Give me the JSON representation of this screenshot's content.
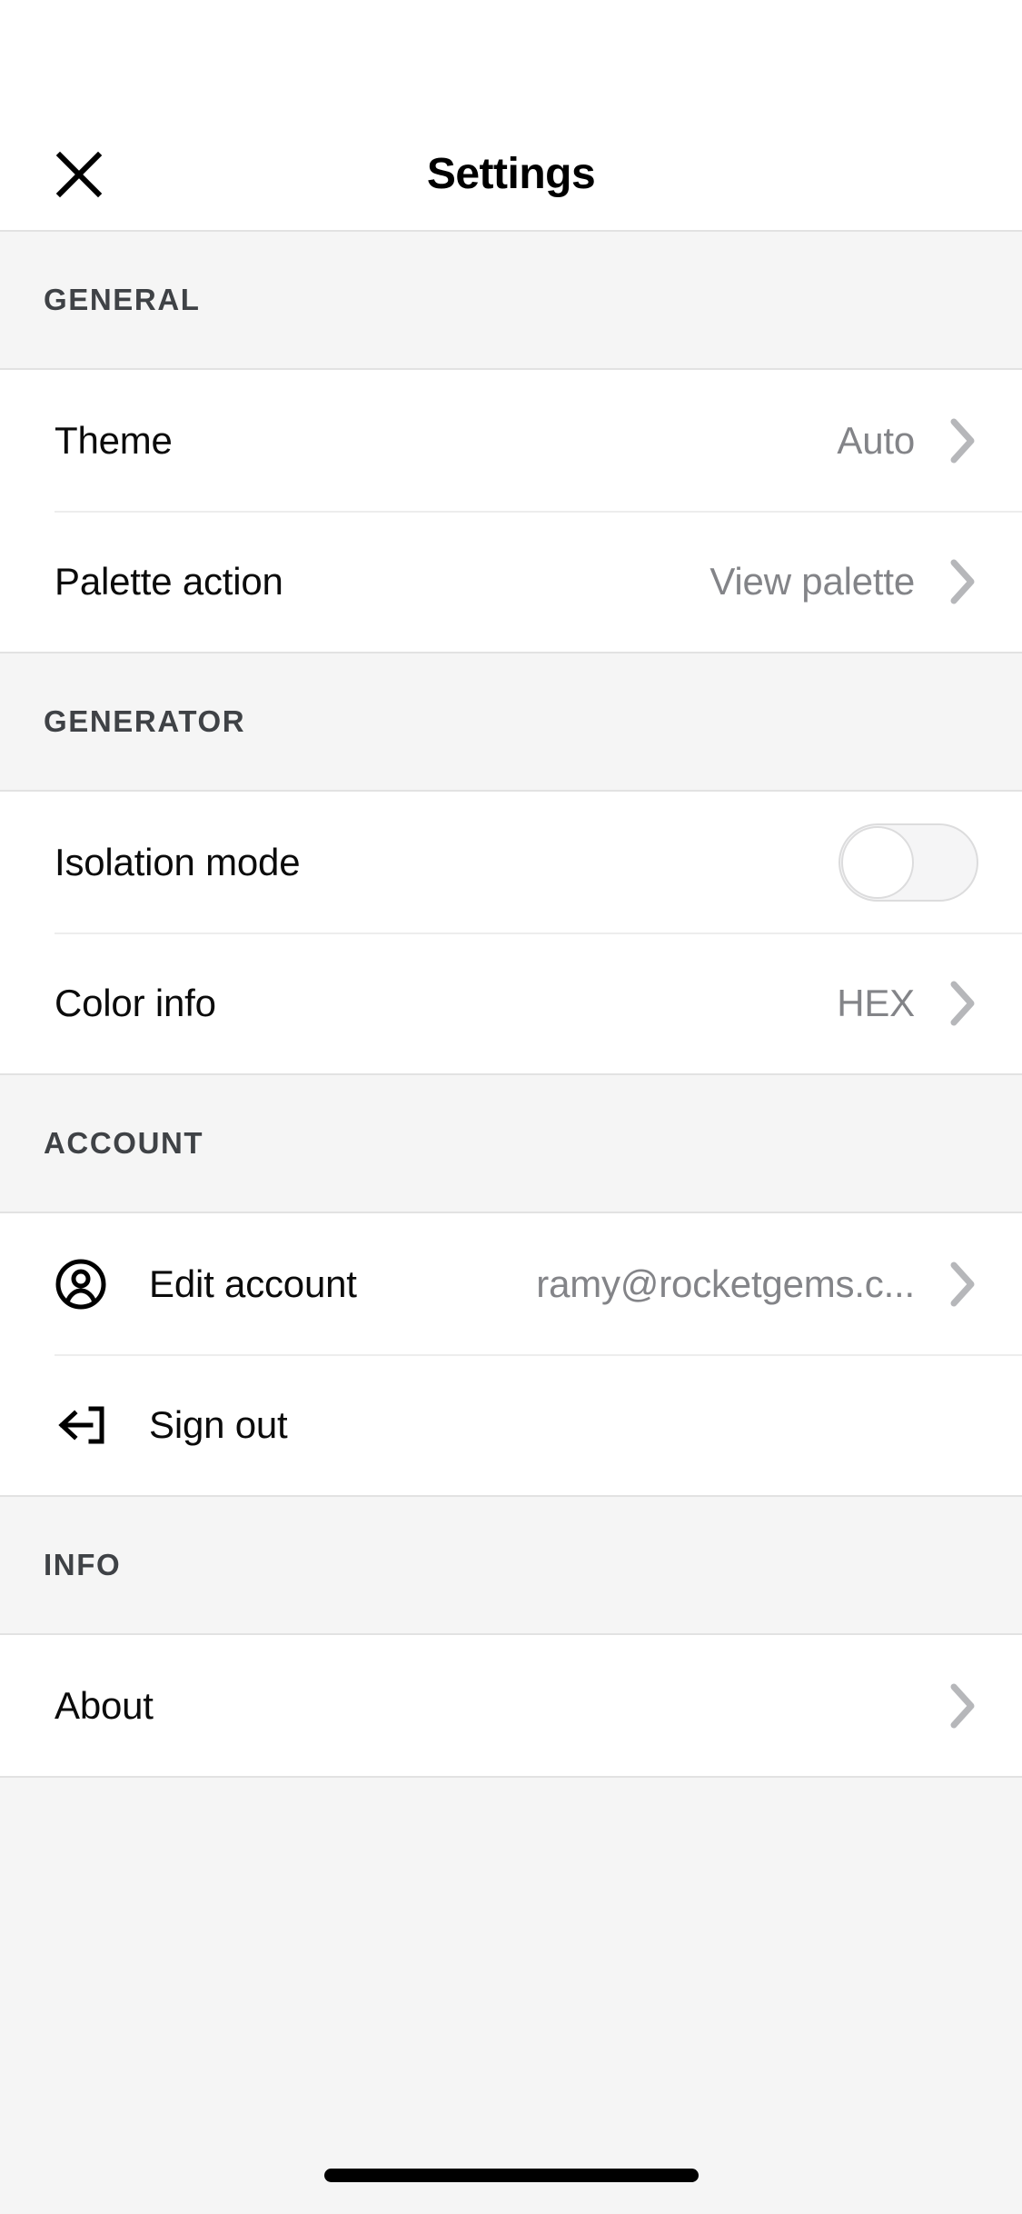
{
  "header": {
    "title": "Settings",
    "close_icon": "close-icon"
  },
  "sections": [
    {
      "key": "general",
      "label": "GENERAL",
      "rows": [
        {
          "key": "theme",
          "label": "Theme",
          "value": "Auto",
          "accessory": "chevron"
        },
        {
          "key": "palette_action",
          "label": "Palette action",
          "value": "View palette",
          "accessory": "chevron"
        }
      ]
    },
    {
      "key": "generator",
      "label": "GENERATOR",
      "rows": [
        {
          "key": "isolation_mode",
          "label": "Isolation mode",
          "value": "",
          "accessory": "toggle",
          "toggle_on": false
        },
        {
          "key": "color_info",
          "label": "Color info",
          "value": "HEX",
          "accessory": "chevron"
        }
      ]
    },
    {
      "key": "account",
      "label": "ACCOUNT",
      "rows": [
        {
          "key": "edit_account",
          "label": "Edit account",
          "value": "ramy@rocketgems.c...",
          "accessory": "chevron",
          "icon": "user-circle-icon"
        },
        {
          "key": "sign_out",
          "label": "Sign out",
          "value": "",
          "accessory": "none",
          "icon": "sign-out-icon"
        }
      ]
    },
    {
      "key": "info",
      "label": "INFO",
      "rows": [
        {
          "key": "about",
          "label": "About",
          "value": "",
          "accessory": "chevron"
        }
      ]
    }
  ],
  "colors": {
    "background": "#f5f5f5",
    "surface": "#ffffff",
    "primary_text": "#0b0b0b",
    "secondary_text": "#838488",
    "section_label": "#3f4246",
    "divider": "#e2e2e2",
    "chevron": "#b6b7ba",
    "home_indicator": "#000000"
  },
  "home_indicator": {
    "visible": true
  }
}
